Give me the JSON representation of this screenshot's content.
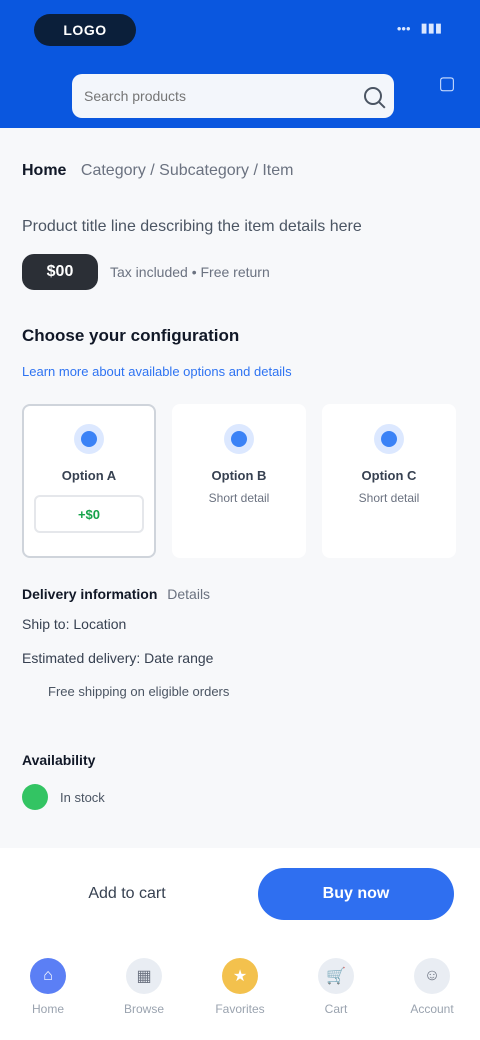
{
  "header": {
    "brand": "LOGO",
    "status": {
      "signal": "•••",
      "battery": "▮▮▮"
    },
    "search": {
      "placeholder": "Search products",
      "value": ""
    },
    "cart_icon": "cart-icon"
  },
  "breadcrumb": {
    "primary": "Home",
    "secondary": "Category / Subcategory / Item"
  },
  "product": {
    "title": "Product title line describing the item details here",
    "price": "$00",
    "price_note": "Tax included • Free return",
    "section_title": "Choose your configuration",
    "section_link": "Learn more about available options and details"
  },
  "variants": [
    {
      "name": "Option A",
      "desc": "",
      "price": "+$0",
      "selected": true
    },
    {
      "name": "Option B",
      "desc": "Short detail",
      "price": "",
      "selected": false
    },
    {
      "name": "Option C",
      "desc": "Short detail",
      "price": "",
      "selected": false
    }
  ],
  "delivery": {
    "title": "Delivery information",
    "title_note": "Details",
    "line2": "Ship to: Location",
    "line3": "Estimated delivery: Date range",
    "line4": "Free shipping on eligible orders"
  },
  "stock": {
    "label": "Availability",
    "status": "In stock"
  },
  "actions": {
    "add_to_cart": "Add to cart",
    "buy_now": "Buy now"
  },
  "tabs": [
    {
      "label": "Home",
      "icon": "home-icon",
      "glyph": "⌂",
      "active": true
    },
    {
      "label": "Browse",
      "icon": "grid-icon",
      "glyph": "▦",
      "active": false
    },
    {
      "label": "Favorites",
      "icon": "star-icon",
      "glyph": "★",
      "active": false
    },
    {
      "label": "Cart",
      "icon": "cart-icon",
      "glyph": "🛒",
      "active": false
    },
    {
      "label": "Account",
      "icon": "user-icon",
      "glyph": "☺",
      "active": false
    }
  ],
  "colors": {
    "header": "#0a57df",
    "primary_button": "#2f6ff0",
    "in_stock": "#33c463",
    "favorite": "#f3c14d"
  }
}
